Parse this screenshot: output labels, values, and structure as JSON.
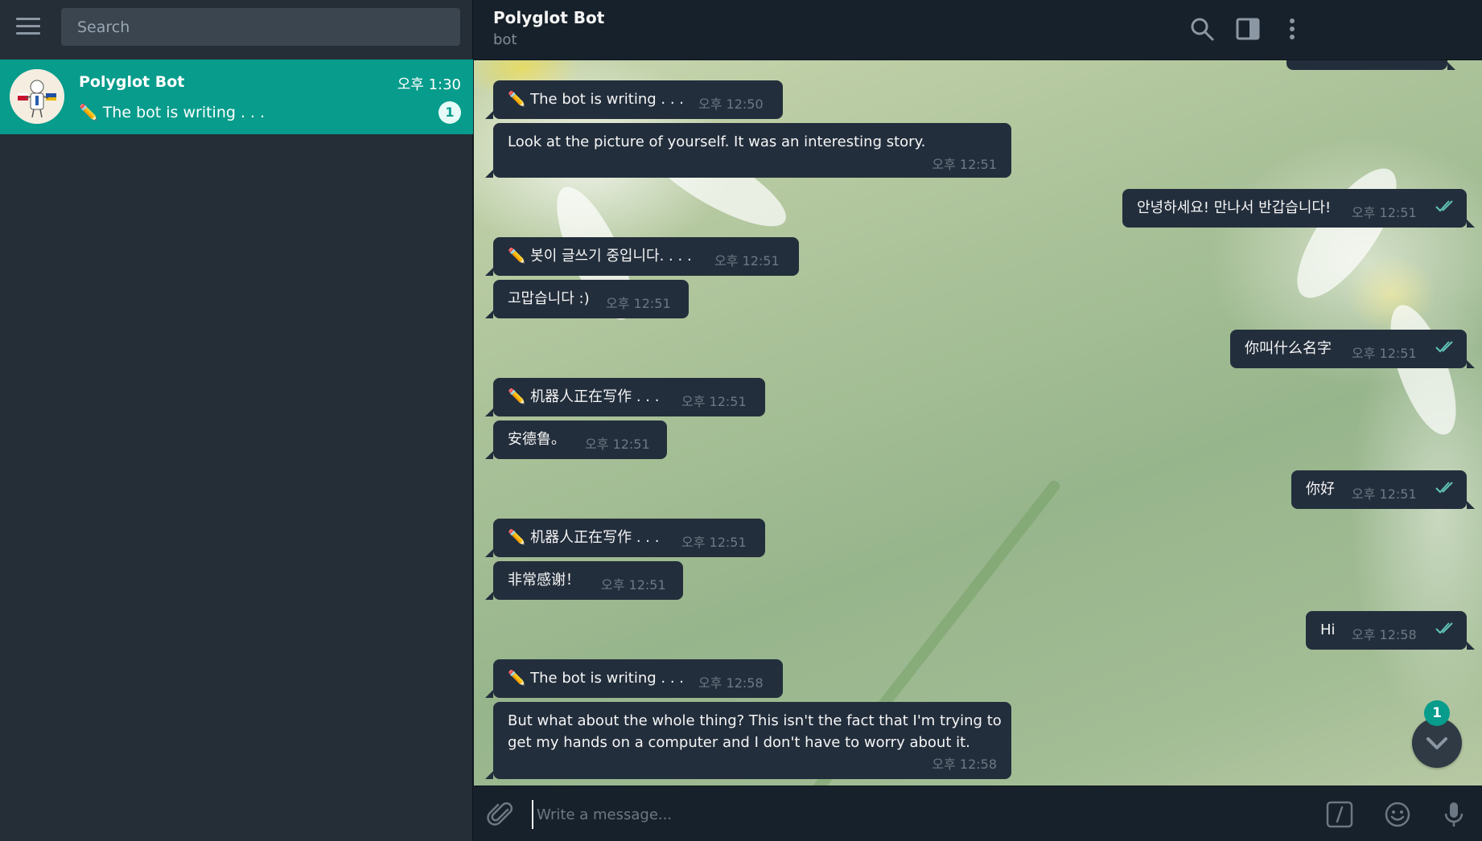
{
  "sidebar": {
    "search_placeholder": "Search",
    "chat": {
      "name": "Polyglot Bot",
      "time": "오후 1:30",
      "preview": "✏️ The bot is writing . . .",
      "unread": "1"
    }
  },
  "header": {
    "title": "Polyglot Bot",
    "status": "bot"
  },
  "messages": [
    {
      "dir": "in",
      "text": "✏️ The bot is writing . . .",
      "time": "오후 12:50"
    },
    {
      "dir": "in",
      "text": "Look at the picture of yourself. It was an interesting story.",
      "time": "오후 12:51"
    },
    {
      "dir": "out",
      "text": "안녕하세요! 만나서 반갑습니다!",
      "time": "오후 12:51"
    },
    {
      "dir": "in",
      "text": "✏️ 봇이 글쓰기 중입니다. . . .",
      "time": "오후 12:51"
    },
    {
      "dir": "in",
      "text": "고맙습니다 :)",
      "time": "오후 12:51"
    },
    {
      "dir": "out",
      "text": "你叫什么名字",
      "time": "오후 12:51"
    },
    {
      "dir": "in",
      "text": "✏️ 机器人正在写作 . . .",
      "time": "오후 12:51"
    },
    {
      "dir": "in",
      "text": "安德鲁。",
      "time": "오후 12:51"
    },
    {
      "dir": "out",
      "text": "你好",
      "time": "오후 12:51"
    },
    {
      "dir": "in",
      "text": "✏️ 机器人正在写作 . . .",
      "time": "오후 12:51"
    },
    {
      "dir": "in",
      "text": "非常感谢！",
      "time": "오후 12:51"
    },
    {
      "dir": "out",
      "text": "Hi",
      "time": "오후 12:58"
    },
    {
      "dir": "in",
      "text": "✏️ The bot is writing . . .",
      "time": "오후 12:58"
    },
    {
      "dir": "in",
      "text_line1": "But what about the whole thing? This isn't the fact that I'm trying to",
      "text_line2": "get my hands on a computer and I don't have to worry about it.",
      "time": "오후 12:58"
    }
  ],
  "scroll_badge": "1",
  "composer": {
    "placeholder": "Write a message..."
  },
  "colors": {
    "accent": "#079c8c",
    "check": "#5fc3b6",
    "bubble": "#232e3c"
  }
}
